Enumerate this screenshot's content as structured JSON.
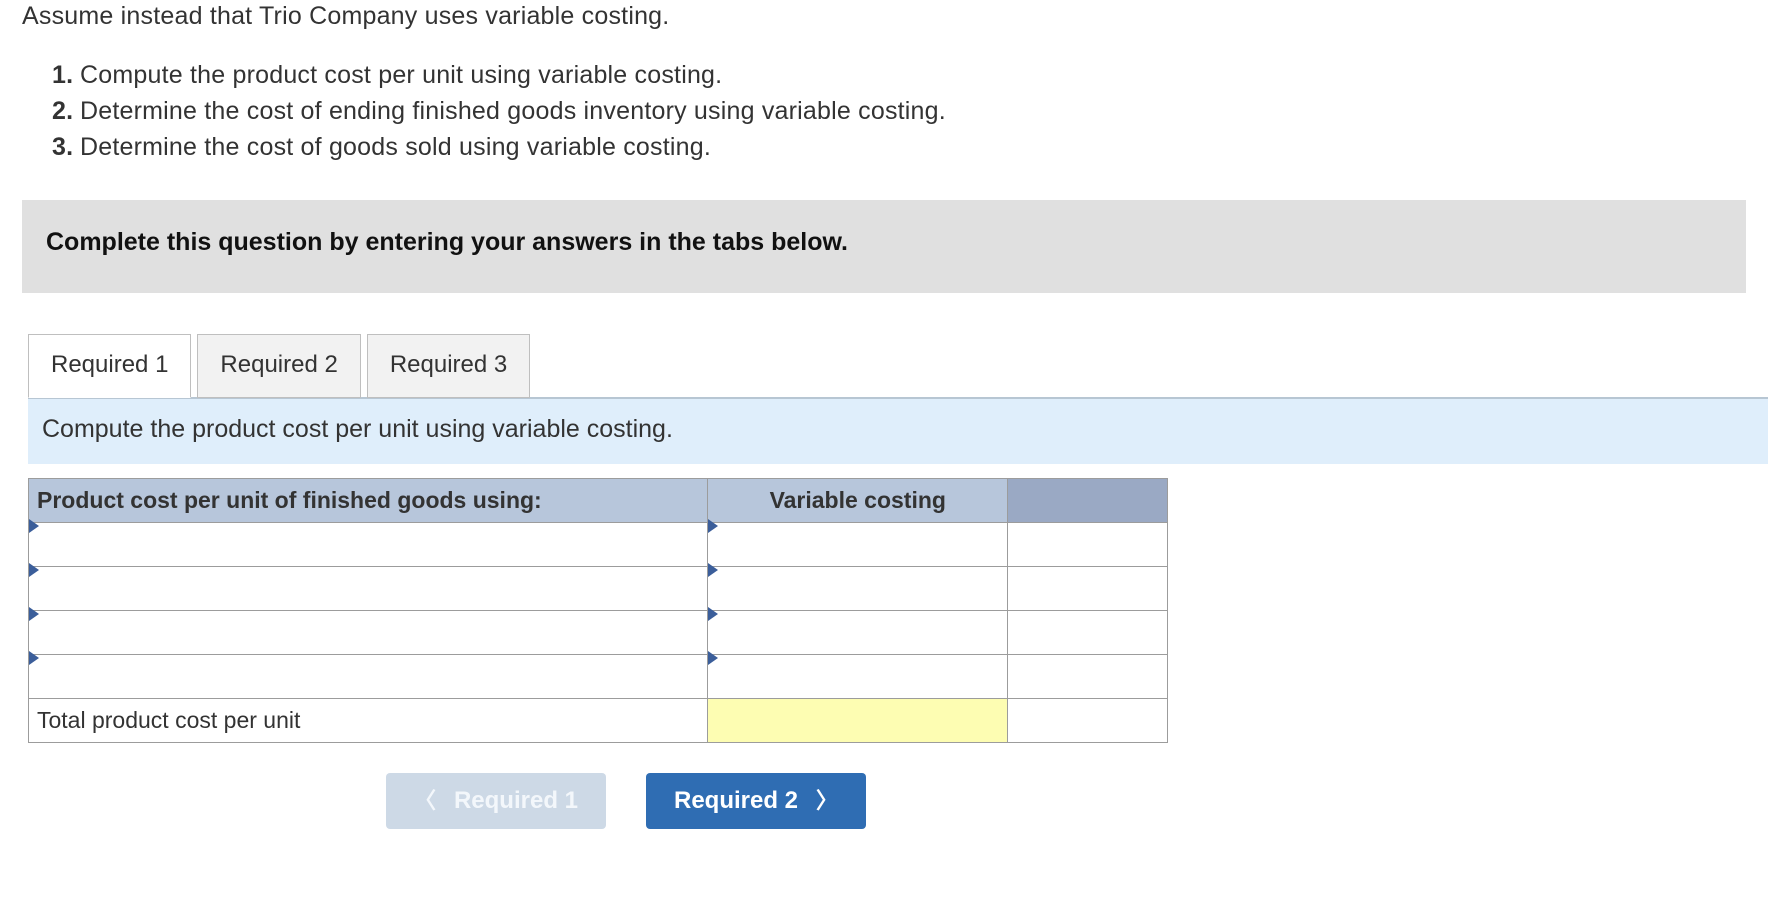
{
  "intro": {
    "lead": "Assume instead that Trio Company uses variable costing.",
    "items": [
      "Compute the product cost per unit using variable costing.",
      "Determine the cost of ending finished goods inventory using variable costing.",
      "Determine the cost of goods sold using variable costing."
    ]
  },
  "instruction": "Complete this question by entering your answers in the tabs below.",
  "tabs": [
    {
      "label": "Required 1"
    },
    {
      "label": "Required 2"
    },
    {
      "label": "Required 3"
    }
  ],
  "tab_body": {
    "prompt": "Compute the product cost per unit using variable costing.",
    "table": {
      "header_left": "Product cost per unit of finished goods using:",
      "header_mid": "Variable costing",
      "rows": [
        {
          "label": "",
          "value": ""
        },
        {
          "label": "",
          "value": ""
        },
        {
          "label": "",
          "value": ""
        },
        {
          "label": "",
          "value": ""
        }
      ],
      "total_label": "Total product cost per unit",
      "total_value": ""
    }
  },
  "nav": {
    "prev": "Required 1",
    "next": "Required 2"
  }
}
